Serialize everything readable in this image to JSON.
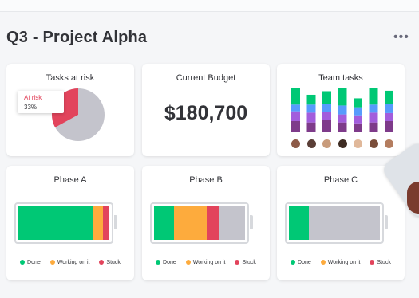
{
  "page": {
    "title": "Q3 - Project Alpha",
    "more_icon": "more-horizontal-icon"
  },
  "cards": {
    "tasks_at_risk": {
      "title": "Tasks at risk",
      "tooltip_label": "At risk",
      "tooltip_value": "33%",
      "at_risk_fraction": 0.33,
      "colors": {
        "risk": "#e2445c",
        "rest": "#c4c4cc"
      }
    },
    "current_budget": {
      "title": "Current Budget",
      "value": "$180,700"
    },
    "team_tasks": {
      "title": "Team tasks",
      "segment_colors": [
        "#7e3b8a",
        "#a25ddc",
        "#579bfc",
        "#00c875"
      ],
      "bars": [
        [
          0.25,
          0.22,
          0.15,
          0.38
        ],
        [
          0.22,
          0.22,
          0.18,
          0.22
        ],
        [
          0.28,
          0.18,
          0.18,
          0.28
        ],
        [
          0.22,
          0.18,
          0.2,
          0.4
        ],
        [
          0.2,
          0.18,
          0.18,
          0.2
        ],
        [
          0.22,
          0.22,
          0.18,
          0.38
        ],
        [
          0.25,
          0.18,
          0.2,
          0.3
        ]
      ],
      "avatar_colors": [
        "#8d5a47",
        "#5a3e36",
        "#c89b7b",
        "#3e2c23",
        "#e0b89a",
        "#7a4e3a",
        "#b47d5f"
      ]
    },
    "phases": [
      {
        "title": "Phase A",
        "segments": [
          {
            "status": "done",
            "fraction": 0.85
          },
          {
            "status": "working",
            "fraction": 0.12
          },
          {
            "status": "stuck",
            "fraction": 0.07
          }
        ]
      },
      {
        "title": "Phase B",
        "segments": [
          {
            "status": "done",
            "fraction": 0.22
          },
          {
            "status": "working",
            "fraction": 0.36
          },
          {
            "status": "stuck",
            "fraction": 0.14
          },
          {
            "status": "empty",
            "fraction": 0.28
          }
        ]
      },
      {
        "title": "Phase C",
        "segments": [
          {
            "status": "done",
            "fraction": 0.22
          },
          {
            "status": "empty",
            "fraction": 0.78
          }
        ]
      }
    ]
  },
  "legend": {
    "done": "Done",
    "working": "Working on it",
    "stuck": "Stuck"
  },
  "status_colors": {
    "done": "#00c875",
    "working": "#fdab3d",
    "stuck": "#e2445c",
    "empty": "#c4c4cc"
  }
}
